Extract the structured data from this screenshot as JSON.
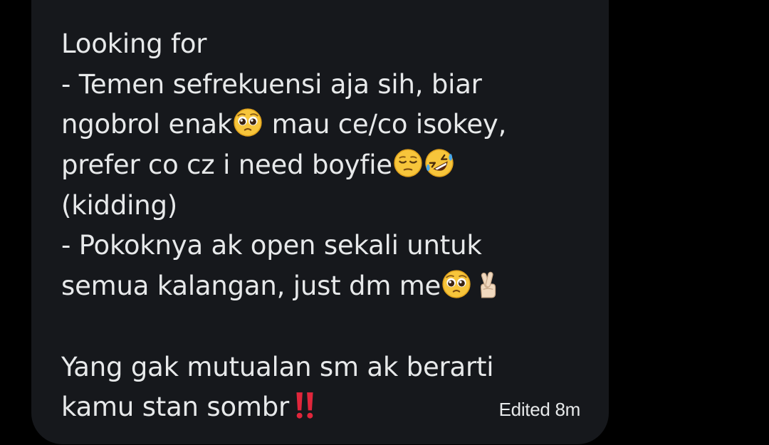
{
  "message": {
    "lines": [
      "Looking for",
      "- Temen sefrekuensi aja sih, biar",
      "ngobrol enak",
      " mau ce/co isokey,",
      "prefer co cz i need boyfie",
      "(kidding)",
      "- Pokoknya ak open sekali untuk",
      "semua kalangan, just dm me",
      "Yang gak mutualan sm ak berarti",
      "kamu stan sombr"
    ],
    "emojis": {
      "pleading": "pleading-face-icon",
      "pensive": "pensive-face-icon",
      "rofl": "rolling-on-floor-laughing-icon",
      "crossed_fingers": "crossed-fingers-icon",
      "double_exclamation": "double-exclamation-icon"
    }
  },
  "meta": {
    "edited_label": "Edited 8m"
  },
  "colors": {
    "background": "#000000",
    "bubble": "#16181c",
    "text": "#e7e9ea",
    "exclamation": "#e0263b"
  }
}
